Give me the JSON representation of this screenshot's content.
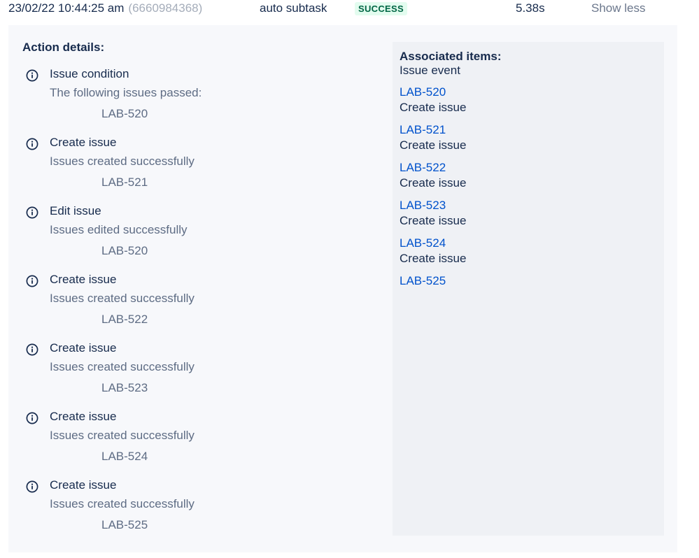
{
  "header": {
    "timestamp": "23/02/22 10:44:25 am",
    "execution_id": "(6660984368)",
    "rule_name": "auto subtask",
    "status": "SUCCESS",
    "duration": "5.38s",
    "toggle_label": "Show less"
  },
  "action_details": {
    "title": "Action details:",
    "actions": [
      {
        "name": "Issue condition",
        "message": "The following issues passed:",
        "issue": "LAB-520"
      },
      {
        "name": "Create issue",
        "message": "Issues created successfully",
        "issue": "LAB-521"
      },
      {
        "name": "Edit issue",
        "message": "Issues edited successfully",
        "issue": "LAB-520"
      },
      {
        "name": "Create issue",
        "message": "Issues created successfully",
        "issue": "LAB-522"
      },
      {
        "name": "Create issue",
        "message": "Issues created successfully",
        "issue": "LAB-523"
      },
      {
        "name": "Create issue",
        "message": "Issues created successfully",
        "issue": "LAB-524"
      },
      {
        "name": "Create issue",
        "message": "Issues created successfully",
        "issue": "LAB-525"
      }
    ]
  },
  "associated_items": {
    "title": "Associated items:",
    "subtitle": "Issue event",
    "items": [
      {
        "key": "LAB-520",
        "label": "Create issue"
      },
      {
        "key": "LAB-521",
        "label": "Create issue"
      },
      {
        "key": "LAB-522",
        "label": "Create issue"
      },
      {
        "key": "LAB-523",
        "label": "Create issue"
      },
      {
        "key": "LAB-524",
        "label": "Create issue"
      },
      {
        "key": "LAB-525",
        "label": ""
      }
    ]
  },
  "icons": {
    "action_icon": "info-circle-icon"
  },
  "colors": {
    "success_bg": "#e3fcef",
    "success_text": "#006644",
    "link": "#0052cc",
    "panel_bg": "#f7f8fb",
    "assoc_bg": "#eff1f5"
  }
}
